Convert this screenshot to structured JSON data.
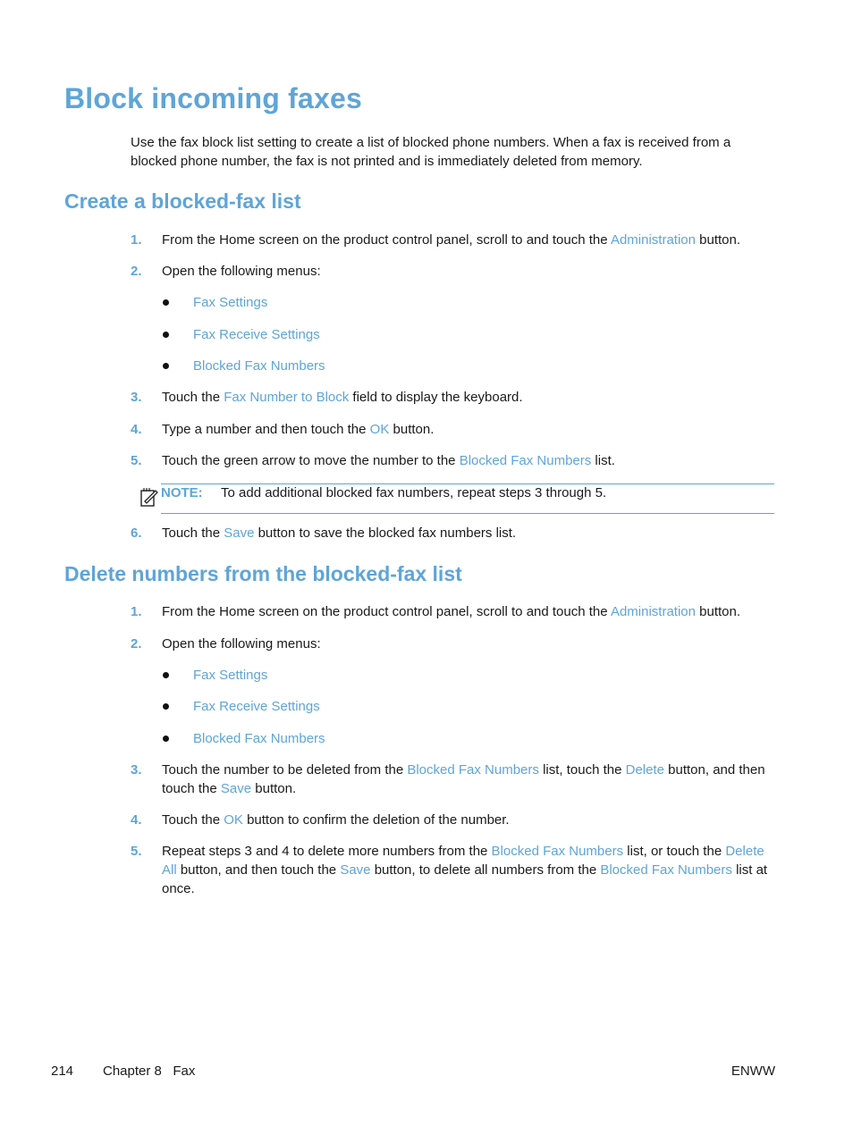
{
  "title": "Block incoming faxes",
  "intro": "Use the fax block list setting to create a list of blocked phone numbers. When a fax is received from a blocked phone number, the fax is not printed and is immediately deleted from memory.",
  "section1": {
    "heading": "Create a blocked-fax list",
    "steps": [
      {
        "num": "1.",
        "parts": [
          "From the Home screen on the product control panel, scroll to and touch the ",
          "Administration",
          " button."
        ]
      },
      {
        "num": "2.",
        "parts": [
          "Open the following menus:"
        ]
      },
      {
        "num": "3.",
        "parts": [
          "Touch the ",
          "Fax Number to Block",
          " field to display the keyboard."
        ]
      },
      {
        "num": "4.",
        "parts": [
          "Type a number and then touch the ",
          "OK",
          " button."
        ]
      },
      {
        "num": "5.",
        "parts": [
          "Touch the green arrow to move the number to the ",
          "Blocked Fax Numbers",
          " list."
        ]
      },
      {
        "num": "6.",
        "parts": [
          "Touch the ",
          "Save",
          " button to save the blocked fax numbers list."
        ]
      }
    ],
    "menus": [
      "Fax Settings",
      "Fax Receive Settings",
      "Blocked Fax Numbers"
    ],
    "note": {
      "label": "NOTE:",
      "text": "To add additional blocked fax numbers, repeat steps 3 through 5."
    }
  },
  "section2": {
    "heading": "Delete numbers from the blocked-fax list",
    "steps": [
      {
        "num": "1.",
        "parts": [
          "From the Home screen on the product control panel, scroll to and touch the ",
          "Administration",
          " button."
        ]
      },
      {
        "num": "2.",
        "parts": [
          "Open the following menus:"
        ]
      },
      {
        "num": "3.",
        "parts": [
          "Touch the number to be deleted from the ",
          "Blocked Fax Numbers",
          " list, touch the ",
          "Delete",
          " button, and then touch the ",
          "Save",
          " button."
        ]
      },
      {
        "num": "4.",
        "parts": [
          "Touch the ",
          "OK",
          " button to confirm the deletion of the number."
        ]
      },
      {
        "num": "5.",
        "parts": [
          "Repeat steps 3 and 4 to delete more numbers from the ",
          "Blocked Fax Numbers",
          " list, or touch the ",
          "Delete All",
          " button, and then touch the ",
          "Save",
          " button, to delete all numbers from the ",
          "Blocked Fax Numbers",
          " list at once."
        ]
      }
    ],
    "menus": [
      "Fax Settings",
      "Fax Receive Settings",
      "Blocked Fax Numbers"
    ]
  },
  "footer": {
    "page": "214",
    "chapter": "Chapter 8   Fax",
    "right": "ENWW"
  }
}
